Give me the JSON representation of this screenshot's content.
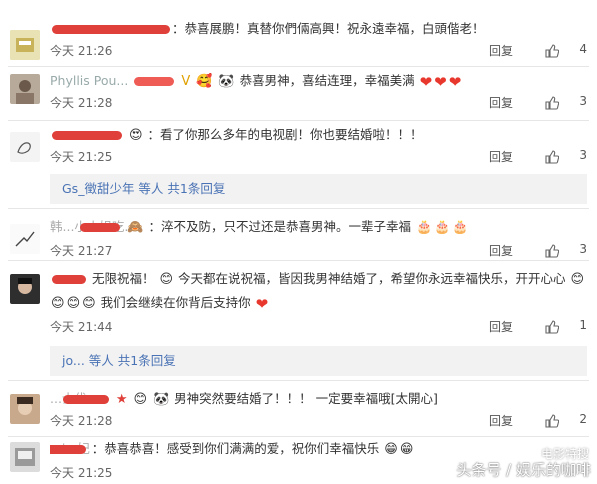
{
  "reply_label": "回复",
  "comments": [
    {
      "user": "",
      "text": "：恭喜展鹏！真替你們倆高興！祝永遠幸福，白頭偕老！",
      "time": "今天 21:26",
      "likes": "4"
    },
    {
      "user": "Phyllis Pou...",
      "text": "恭喜男神，喜结连理，幸福美满",
      "time": "今天 21:28",
      "likes": "3"
    },
    {
      "user": "",
      "text": "：看了你那么多年的电视剧！你也要结婚啦！！！",
      "time": "今天 21:25",
      "likes": "3",
      "sub_reply": "Gs_徵甜少年 等人 共1条回复"
    },
    {
      "user": "韩...小小姐吃...",
      "text": "：淬不及防，只不过还是恭喜男神。一辈子幸福",
      "time": "今天 21:27",
      "likes": "3"
    },
    {
      "user": "",
      "text": "无限祝福！",
      "text_b": "今天都在说祝福，皆因我男神结婚了，希望你永远幸福快乐，开开心心",
      "text2": "我们会继续在你背后支持你",
      "time": "今天 21:44",
      "likes": "1",
      "sub_reply": "jo... 等人 共1条回复"
    },
    {
      "user": "...士伐...",
      "text": "男神突然要结婚了！！！",
      "text_b": "一定要幸福哦[太開心]",
      "time": "今天 21:28",
      "likes": "2"
    },
    {
      "user": "...i...妃",
      "text": "：恭喜恭喜！感受到你们满满的爱，祝你们幸福快乐",
      "time": "今天 21:25",
      "likes": ""
    }
  ],
  "watermark": {
    "channel": "电影特搜",
    "text": "头条号 / 娱乐的咖啡"
  }
}
